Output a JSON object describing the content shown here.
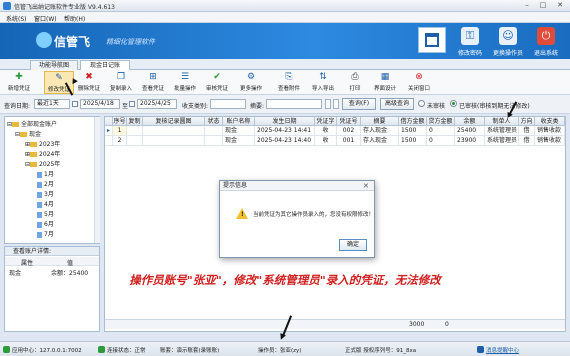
{
  "window": {
    "title": "信管飞出纳记账软件专业版 V9.4.613"
  },
  "menu": [
    "系统(S)",
    "窗口(W)",
    "帮助(H)"
  ],
  "banner": {
    "logo": "信管飞",
    "slogan": "精细化管理软件",
    "buttons": [
      "修改密码",
      "更换操作员",
      "退出系统"
    ]
  },
  "tabs": [
    "功能导航图",
    "现金日记账"
  ],
  "toolbar": [
    "新增凭证",
    "修改凭证",
    "删除凭证",
    "复制录入",
    "查看凭证",
    "批量操作",
    "审核凭证",
    "更多操作",
    "查看附件",
    "导入导出",
    "打印",
    "界面设计",
    "关闭窗口"
  ],
  "query": {
    "date_label": "查询日期:",
    "period": "最近1天",
    "date_from": "2025/4/18",
    "to_label": "至",
    "date_to": "2025/4/25",
    "category_label": "收支类别:",
    "summary_label": "摘要:",
    "query_btn": "查询(F)",
    "advanced_btn": "高级查询",
    "radio_unaudited": "未审核",
    "radio_audited": "已审核(审核到期无法修改)"
  },
  "tree": {
    "root": "全部现金账户",
    "account": "现金",
    "years": [
      "2023年",
      "2024年",
      "2025年"
    ],
    "months": [
      "1月",
      "2月",
      "3月",
      "4月",
      "5月",
      "6月",
      "7月"
    ]
  },
  "props": {
    "title": "查看账户详情:",
    "col_attr": "属性",
    "col_value": "值",
    "rows": [
      {
        "attr": "现金",
        "value": "余额：25400"
      }
    ]
  },
  "grid": {
    "columns": [
      "序号",
      "复制",
      "复核记录圆图",
      "状态",
      "账户名称",
      "发生日期",
      "凭证字",
      "凭证号",
      "摘要",
      "借方金额",
      "贷方金额",
      "余额",
      "制单人",
      "方向",
      "收支类"
    ],
    "rows": [
      [
        "1",
        "",
        "",
        "",
        "现金",
        "2025-04-23 14:41",
        "收",
        "002",
        "存入现金",
        "1500",
        "0",
        "25400",
        "系统管理员",
        "借",
        "销售收款"
      ],
      [
        "2",
        "",
        "",
        "",
        "现金",
        "2025-04-23 14:40",
        "收",
        "001",
        "存入现金",
        "1500",
        "0",
        "23900",
        "系统管理员",
        "借",
        "销售收款"
      ]
    ],
    "footer": {
      "debit_total": "3000",
      "credit_total": "0"
    }
  },
  "dialog": {
    "title": "提示信息",
    "message": "当前凭证为其它操作员录入的，您没有权限修改！",
    "ok": "确定"
  },
  "annotation": "操作员账号\"张亚\"，修改\"系统管理员\"录入的凭证，无法修改",
  "status": {
    "app_center": "应用中心：127.0.0.1:7002",
    "connection": "连接状态：正常",
    "account_set": "账套：演示账套(录账账)",
    "operator": "操作员：张亚(zy)",
    "version": "正式版 授权序列号：91_8xa",
    "feedback": "消息提醒中心"
  }
}
